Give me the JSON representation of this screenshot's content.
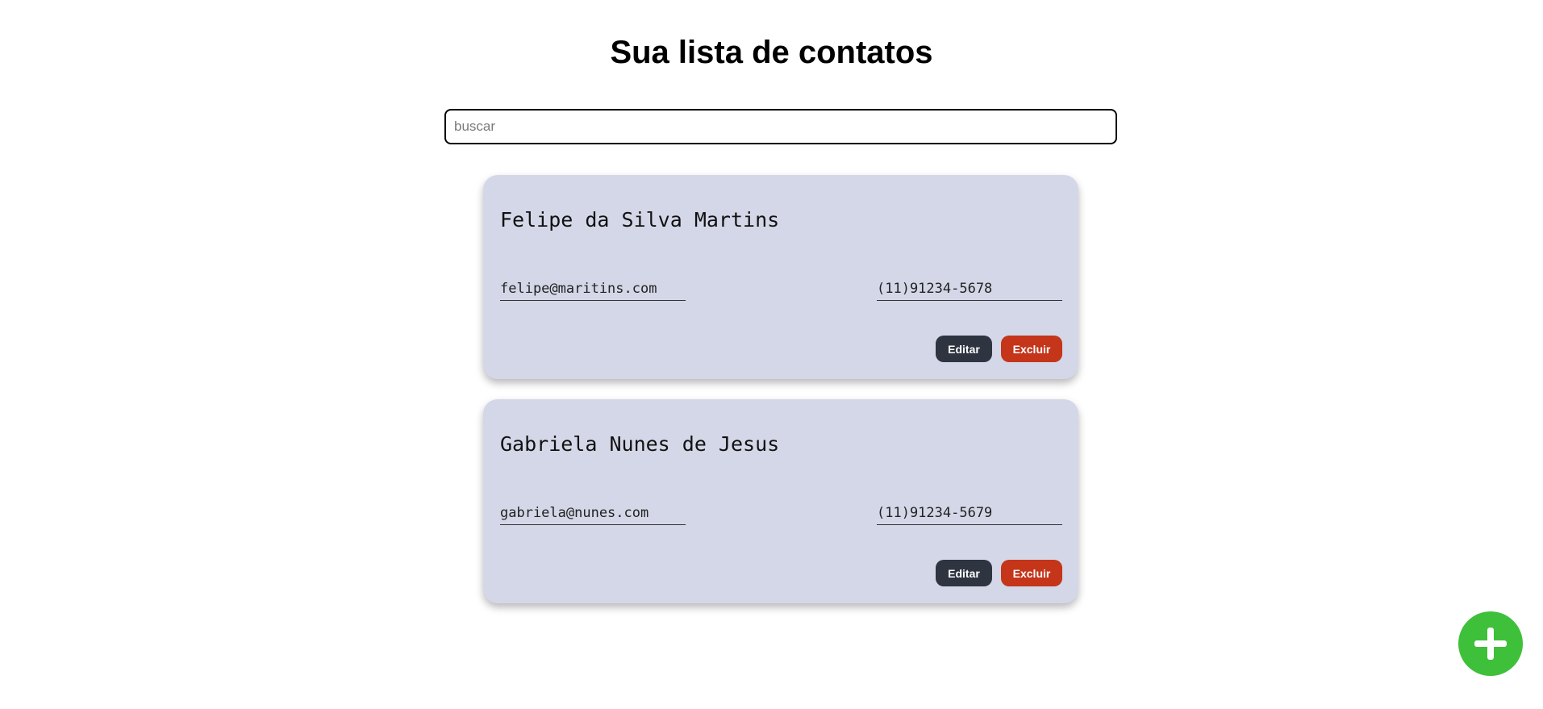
{
  "header": {
    "title": "Sua lista de contatos"
  },
  "search": {
    "placeholder": "buscar",
    "value": ""
  },
  "contacts": [
    {
      "name": "Felipe da Silva Martins",
      "email": "felipe@maritins.com",
      "phone": "(11)91234-5678",
      "edit_label": "Editar",
      "delete_label": "Excluir"
    },
    {
      "name": "Gabriela Nunes de Jesus",
      "email": "gabriela@nunes.com",
      "phone": "(11)91234-5679",
      "edit_label": "Editar",
      "delete_label": "Excluir"
    }
  ],
  "fab": {
    "icon": "plus-icon"
  },
  "colors": {
    "card_background": "#d4d7e7",
    "edit_button": "#2f3540",
    "delete_button": "#c4351a",
    "add_button": "#3fc03a"
  }
}
